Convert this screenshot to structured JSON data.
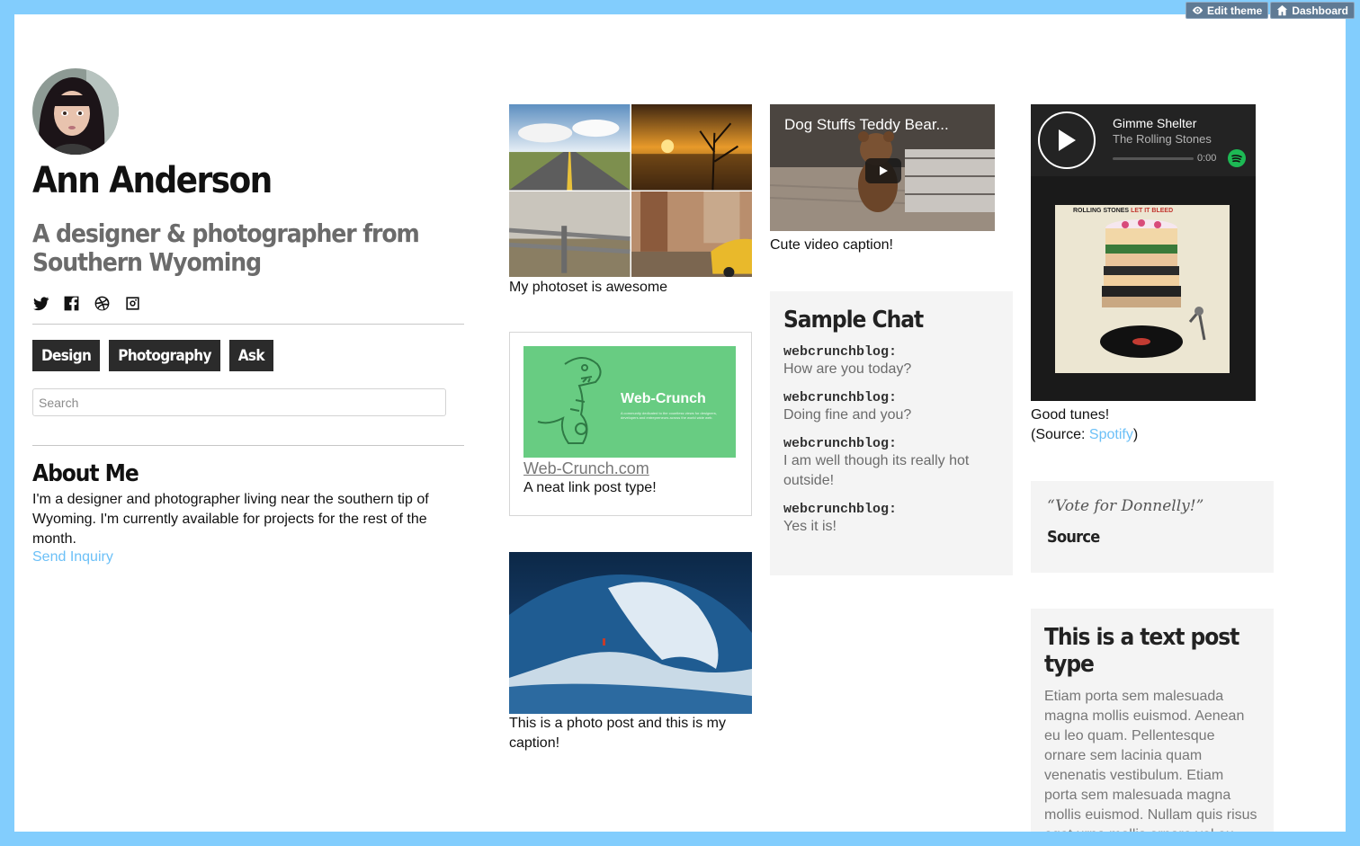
{
  "admin": {
    "edit_theme": "Edit theme",
    "dashboard": "Dashboard"
  },
  "profile": {
    "name": "Ann Anderson",
    "tagline": "A designer & photographer from Southern Wyoming",
    "social_icons": [
      "twitter-icon",
      "facebook-icon",
      "dribbble-icon",
      "instagram-icon"
    ]
  },
  "nav": {
    "items": [
      {
        "label": "Design"
      },
      {
        "label": "Photography"
      },
      {
        "label": "Ask"
      }
    ]
  },
  "search": {
    "placeholder": "Search",
    "value": ""
  },
  "about": {
    "title": "About Me",
    "text": "I'm a designer and photographer living near the southern tip of Wyoming. I'm currently available for projects for the rest of the month.",
    "link": "Send Inquiry"
  },
  "posts": {
    "photoset": {
      "caption": "My photoset is awesome"
    },
    "link": {
      "image_title": "Web-Crunch",
      "image_blurb": "A community dedicated to the countless views for designers, developers and entrepreneurs across the world wide web.",
      "url_text": "Web-Crunch.com",
      "description": "A neat link post type!"
    },
    "photo": {
      "caption": "This is a photo post and this is my caption!"
    },
    "video": {
      "title": "Dog Stuffs Teddy Bear...",
      "caption": "Cute video caption!"
    },
    "chat": {
      "title": "Sample Chat",
      "lines": [
        {
          "speaker": "webcrunchblog:",
          "text": "How are you today?"
        },
        {
          "speaker": "webcrunchblog:",
          "text": "Doing fine and you?"
        },
        {
          "speaker": "webcrunchblog:",
          "text": "I am well though its really hot outside!"
        },
        {
          "speaker": "webcrunchblog:",
          "text": "Yes it is!"
        }
      ]
    },
    "audio": {
      "track": "Gimme Shelter",
      "artist": "The Rolling Stones",
      "time": "0:00",
      "album_band": "ROLLING STONES",
      "album_title": "LET IT BLEED",
      "caption": "Good tunes!",
      "source_prefix": "(Source: ",
      "source_link": "Spotify",
      "source_suffix": ")"
    },
    "quote": {
      "text": "“Vote for Donnelly!”",
      "source": "Source"
    },
    "text": {
      "title": "This is a text post type",
      "body": "Etiam porta sem malesuada magna mollis euismod. Aenean eu leo quam. Pellentesque ornare sem lacinia quam venenatis vestibulum. Etiam porta sem malesuada magna mollis euismod. Nullam quis risus eget urna mollis ornare vel eu leo. Nullam quis risus eget urna mollis ornare vel eu leo."
    }
  },
  "colors": {
    "frame": "#82cdfd",
    "accent_link": "#6cc0f7",
    "nav_bg": "#2b2b2b",
    "card_bg": "#f4f4f4",
    "spotify_green": "#1db954"
  }
}
